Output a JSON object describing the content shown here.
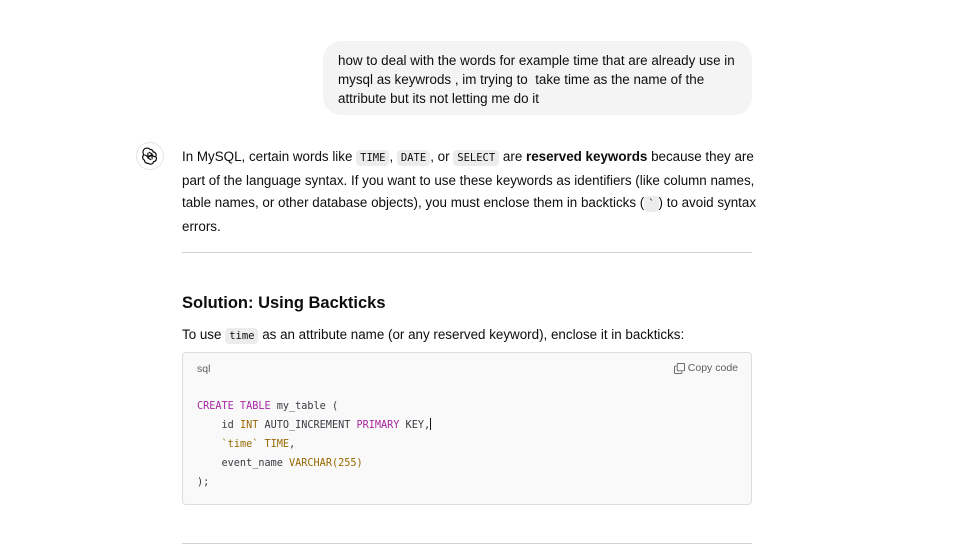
{
  "user_message": {
    "text": "how to deal with the words for example time that are already use in mysql as keywrods , im trying to  take time as the name of the attribute but its not letting me do it"
  },
  "assistant": {
    "avatar_icon": "openai-logo-icon",
    "intro": {
      "t1": "In MySQL, certain words like ",
      "c1": "TIME",
      "t2": ", ",
      "c2": "DATE",
      "t3": ", or ",
      "c3": "SELECT",
      "t4": " are ",
      "b1": "reserved keywords",
      "t5": " because they are part of the language syntax. If you want to use these keywords as identifiers (like column names, table names, or other database objects), you must enclose them in backticks (",
      "c4": "`",
      "t6": ") to avoid syntax errors."
    },
    "solution_heading": "Solution: Using Backticks",
    "solution_intro": {
      "t1": "To use ",
      "c1": "time",
      "t2": " as an attribute name (or any reserved keyword), enclose it in backticks:"
    },
    "code_block": {
      "language": "sql",
      "copy_label": "Copy code",
      "lines": {
        "l1_kw": "CREATE TABLE",
        "l1_rest": " my_table (",
        "l2_indent": "    id ",
        "l2_ty": "INT",
        "l2_mid": " AUTO_INCREMENT ",
        "l2_kw": "PRIMARY",
        "l2_rest": " KEY,",
        "l3_indent": "    ",
        "l3_str": "`time`",
        "l3_sp": " ",
        "l3_ty": "TIME",
        "l3_rest": ",",
        "l4_indent": "    event_name ",
        "l4_ty": "VARCHAR(255)",
        "l5": ");"
      }
    }
  },
  "colors": {
    "keyword": "#a626a4",
    "type": "#986801",
    "bubble_bg": "#f4f4f4",
    "code_bg": "#f9f9f9"
  }
}
